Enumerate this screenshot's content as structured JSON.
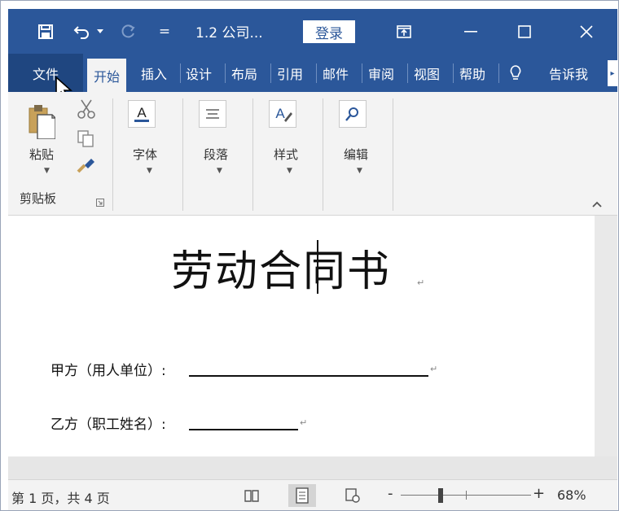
{
  "titlebar": {
    "document_title": "1.2 公司...",
    "login_label": "登录",
    "quick_access_more": "="
  },
  "tabs": [
    {
      "label": "文件"
    },
    {
      "label": "开始"
    },
    {
      "label": "插入"
    },
    {
      "label": "设计"
    },
    {
      "label": "布局"
    },
    {
      "label": "引用"
    },
    {
      "label": "邮件"
    },
    {
      "label": "审阅"
    },
    {
      "label": "视图"
    },
    {
      "label": "帮助"
    },
    {
      "label": "告诉我"
    }
  ],
  "ribbon": {
    "paste_label": "粘贴",
    "clipboard_group_label": "剪贴板",
    "font_label": "字体",
    "paragraph_label": "段落",
    "styles_label": "样式",
    "editing_label": "编辑"
  },
  "document": {
    "title": "劳动合同书",
    "party_a_label": "甲方（用人单位）:",
    "party_b_label": "乙方（职工姓名）:"
  },
  "statusbar": {
    "page_info": "第 1 页，共 4 页",
    "zoom_minus": "-",
    "zoom_plus": "+",
    "zoom_level": "68%"
  },
  "colors": {
    "accent": "#2b579a",
    "ribbon_bg": "#f3f3f3"
  }
}
